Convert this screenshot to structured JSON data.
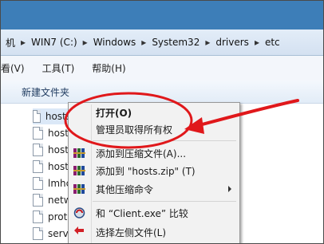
{
  "address_bar": {
    "crumbs": [
      "机",
      "WIN7 (C:)",
      "Windows",
      "System32",
      "drivers",
      "etc"
    ]
  },
  "menu_bar": {
    "items": [
      "查看(V)",
      "工具(T)",
      "帮助(H)"
    ]
  },
  "toolbar": {
    "new_folder": "新建文件夹"
  },
  "file_list": {
    "files": [
      "hosts",
      "hosts",
      "hosts",
      "hosts",
      "lmhc",
      "netw",
      "prot",
      "serv"
    ]
  },
  "context_menu": {
    "items": {
      "open": "打开(O)",
      "take_ownership": "管理员取得所有权",
      "add_to_archive": "添加到压缩文件(A)...",
      "add_to_hosts_zip": "添加到 \"hosts.zip\" (T)",
      "other_compress": "其他压缩命令",
      "compare_with_client": "和 “Client.exe” 比较",
      "select_left_file": "选择左侧文件(L)"
    }
  },
  "colors": {
    "annotation_red": "#e0181b",
    "title_bar_blue": "#3d7eb8"
  }
}
